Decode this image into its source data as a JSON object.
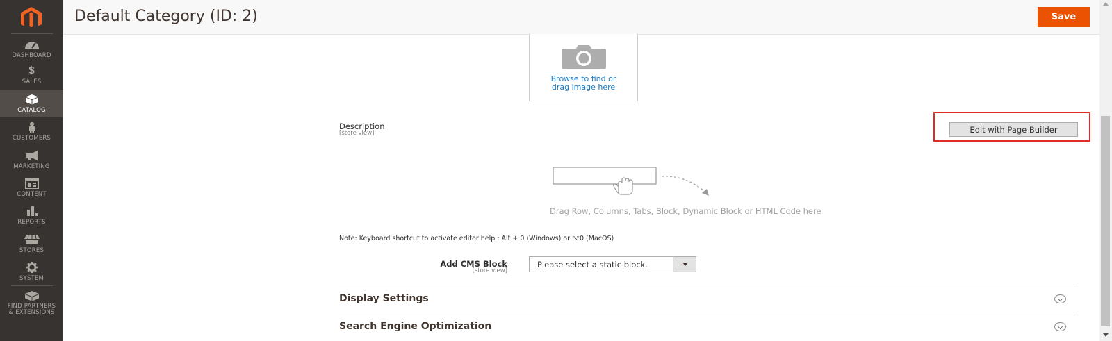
{
  "sidebar": {
    "items": [
      {
        "label": "DASHBOARD",
        "icon": "dashboard-icon"
      },
      {
        "label": "SALES",
        "icon": "dollar-icon"
      },
      {
        "label": "CATALOG",
        "icon": "box-icon",
        "active": true
      },
      {
        "label": "CUSTOMERS",
        "icon": "person-icon"
      },
      {
        "label": "MARKETING",
        "icon": "megaphone-icon"
      },
      {
        "label": "CONTENT",
        "icon": "layout-icon"
      },
      {
        "label": "REPORTS",
        "icon": "bar-chart-icon"
      },
      {
        "label": "STORES",
        "icon": "storefront-icon"
      },
      {
        "label": "SYSTEM",
        "icon": "gear-icon"
      },
      {
        "label": "FIND PARTNERS & EXTENSIONS",
        "line1": "FIND PARTNERS",
        "line2": "& EXTENSIONS",
        "icon": "extensions-icon"
      }
    ]
  },
  "header": {
    "title": "Default Category (ID: 2)",
    "save_label": "Save"
  },
  "image_upload": {
    "line1": "Browse to find or",
    "line2": "drag image here"
  },
  "description": {
    "label": "Description",
    "scope": "[store view]",
    "page_builder_button": "Edit with Page Builder",
    "drop_hint": "Drag Row, Columns, Tabs, Block, Dynamic Block or HTML Code here",
    "note": "Note: Keyboard shortcut to activate editor help : Alt + 0 (Windows) or ⌥0 (MacOS)"
  },
  "cms_block": {
    "label": "Add CMS Block",
    "scope": "[store view]",
    "selected": "Please select a static block."
  },
  "sections": [
    {
      "title": "Display Settings"
    },
    {
      "title": "Search Engine Optimization"
    }
  ],
  "colors": {
    "sidebar_bg": "#373330",
    "accent": "#eb5202",
    "highlight": "#e02b27",
    "link": "#1979c3"
  }
}
